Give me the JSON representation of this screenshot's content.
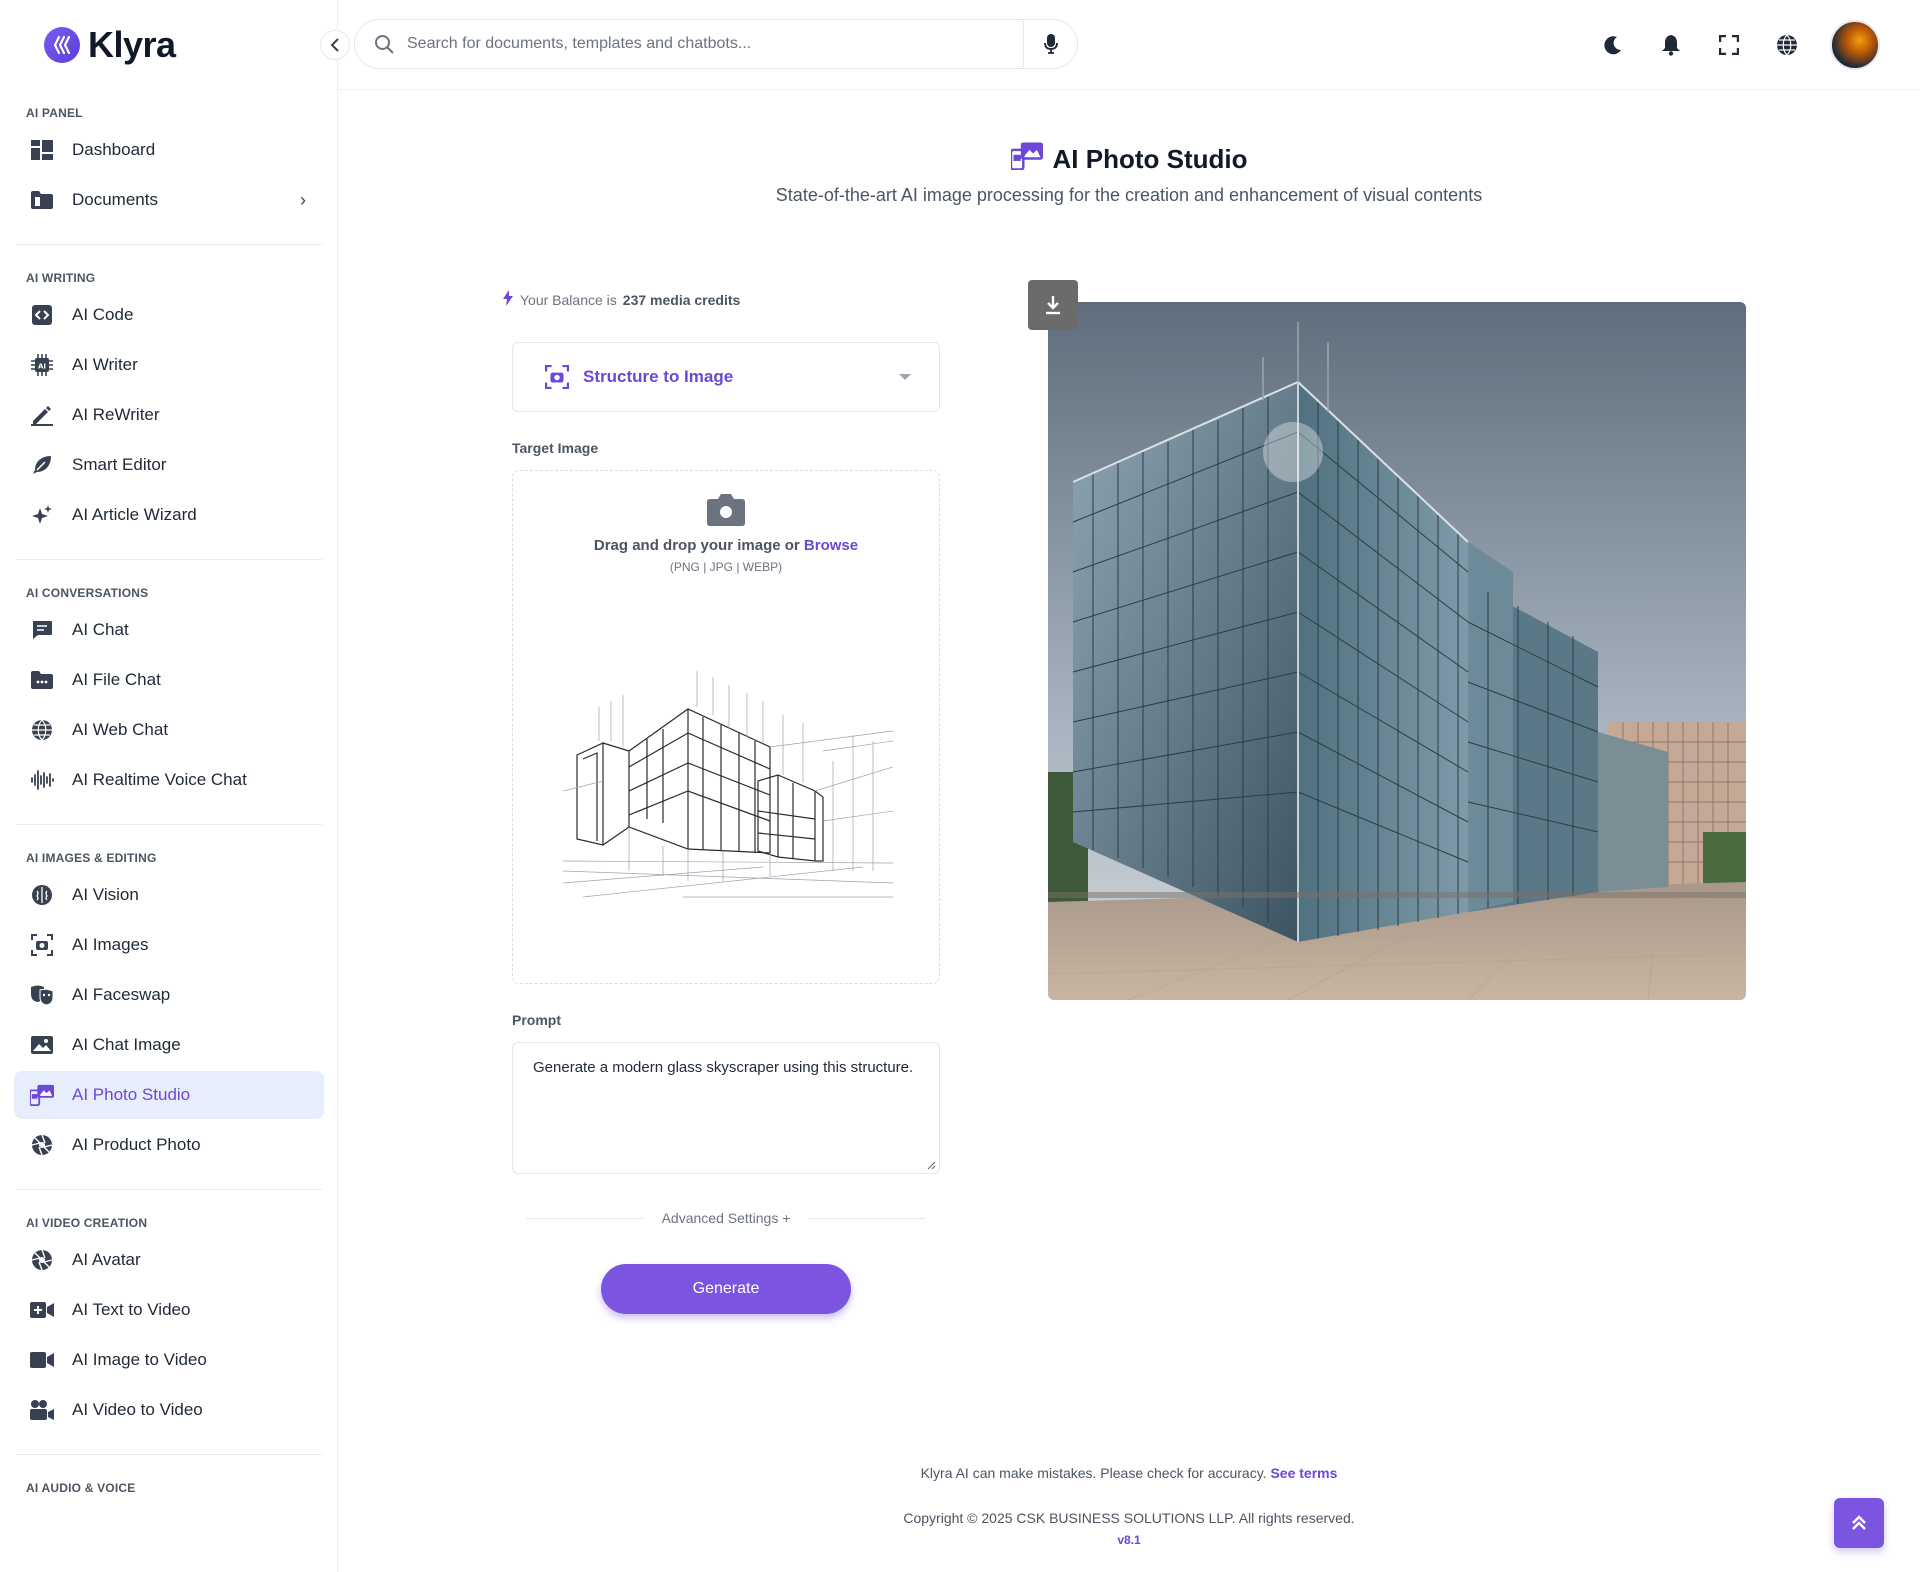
{
  "app": {
    "name": "Klyra"
  },
  "sidebar": {
    "sections": [
      {
        "label": "AI PANEL",
        "items": [
          {
            "label": "Dashboard",
            "icon": "dashboard-icon"
          },
          {
            "label": "Documents",
            "icon": "folder-icon",
            "has_submenu": true
          }
        ]
      },
      {
        "label": "AI WRITING",
        "items": [
          {
            "label": "AI Code",
            "icon": "code-icon"
          },
          {
            "label": "AI Writer",
            "icon": "chip-icon"
          },
          {
            "label": "AI ReWriter",
            "icon": "pen-icon"
          },
          {
            "label": "Smart Editor",
            "icon": "feather-icon"
          },
          {
            "label": "AI Article Wizard",
            "icon": "sparkles-icon"
          }
        ]
      },
      {
        "label": "AI CONVERSATIONS",
        "items": [
          {
            "label": "AI Chat",
            "icon": "chat-icon"
          },
          {
            "label": "AI File Chat",
            "icon": "file-chat-icon"
          },
          {
            "label": "AI Web Chat",
            "icon": "globe-icon"
          },
          {
            "label": "AI Realtime Voice Chat",
            "icon": "waveform-icon"
          }
        ]
      },
      {
        "label": "AI IMAGES & EDITING",
        "items": [
          {
            "label": "AI Vision",
            "icon": "brain-icon"
          },
          {
            "label": "AI Images",
            "icon": "camera-frame-icon"
          },
          {
            "label": "AI Faceswap",
            "icon": "masks-icon"
          },
          {
            "label": "AI Chat Image",
            "icon": "image-icon"
          },
          {
            "label": "AI Photo Studio",
            "icon": "photo-studio-icon",
            "active": true
          },
          {
            "label": "AI Product Photo",
            "icon": "aperture-icon"
          }
        ]
      },
      {
        "label": "AI VIDEO CREATION",
        "items": [
          {
            "label": "AI Avatar",
            "icon": "aperture-icon"
          },
          {
            "label": "AI Text to Video",
            "icon": "video-plus-icon"
          },
          {
            "label": "AI Image to Video",
            "icon": "video-icon"
          },
          {
            "label": "AI Video to Video",
            "icon": "video-camera-icon"
          }
        ]
      },
      {
        "label": "AI AUDIO & VOICE",
        "items": []
      }
    ]
  },
  "topbar": {
    "search_placeholder": "Search for documents, templates and chatbots...",
    "icons": [
      "moon-icon",
      "bell-icon",
      "fullscreen-icon",
      "globe-icon"
    ]
  },
  "page": {
    "title": "AI Photo Studio",
    "subtitle": "State-of-the-art AI image processing for the creation and enhancement of visual contents"
  },
  "balance": {
    "prefix": "Your Balance is",
    "value": "237 media credits"
  },
  "mode": {
    "selected": "Structure to Image"
  },
  "target_image": {
    "label": "Target Image",
    "drop_text": "Drag and drop your image or",
    "browse": "Browse",
    "formats": "(PNG | JPG | WEBP)"
  },
  "prompt": {
    "label": "Prompt",
    "value": "Generate a modern glass skyscraper using this structure."
  },
  "advanced": {
    "label": "Advanced Settings +"
  },
  "generate": {
    "label": "Generate"
  },
  "footer": {
    "note": "Klyra AI can make mistakes. Please check for accuracy.",
    "terms": "See terms",
    "copyright": "Copyright © 2025 CSK BUSINESS SOLUTIONS LLP. All rights reserved.",
    "version": "v8.1"
  },
  "colors": {
    "accent": "#7b55e0",
    "accent_text": "#6c47d8",
    "active_bg": "#e6eefc"
  }
}
